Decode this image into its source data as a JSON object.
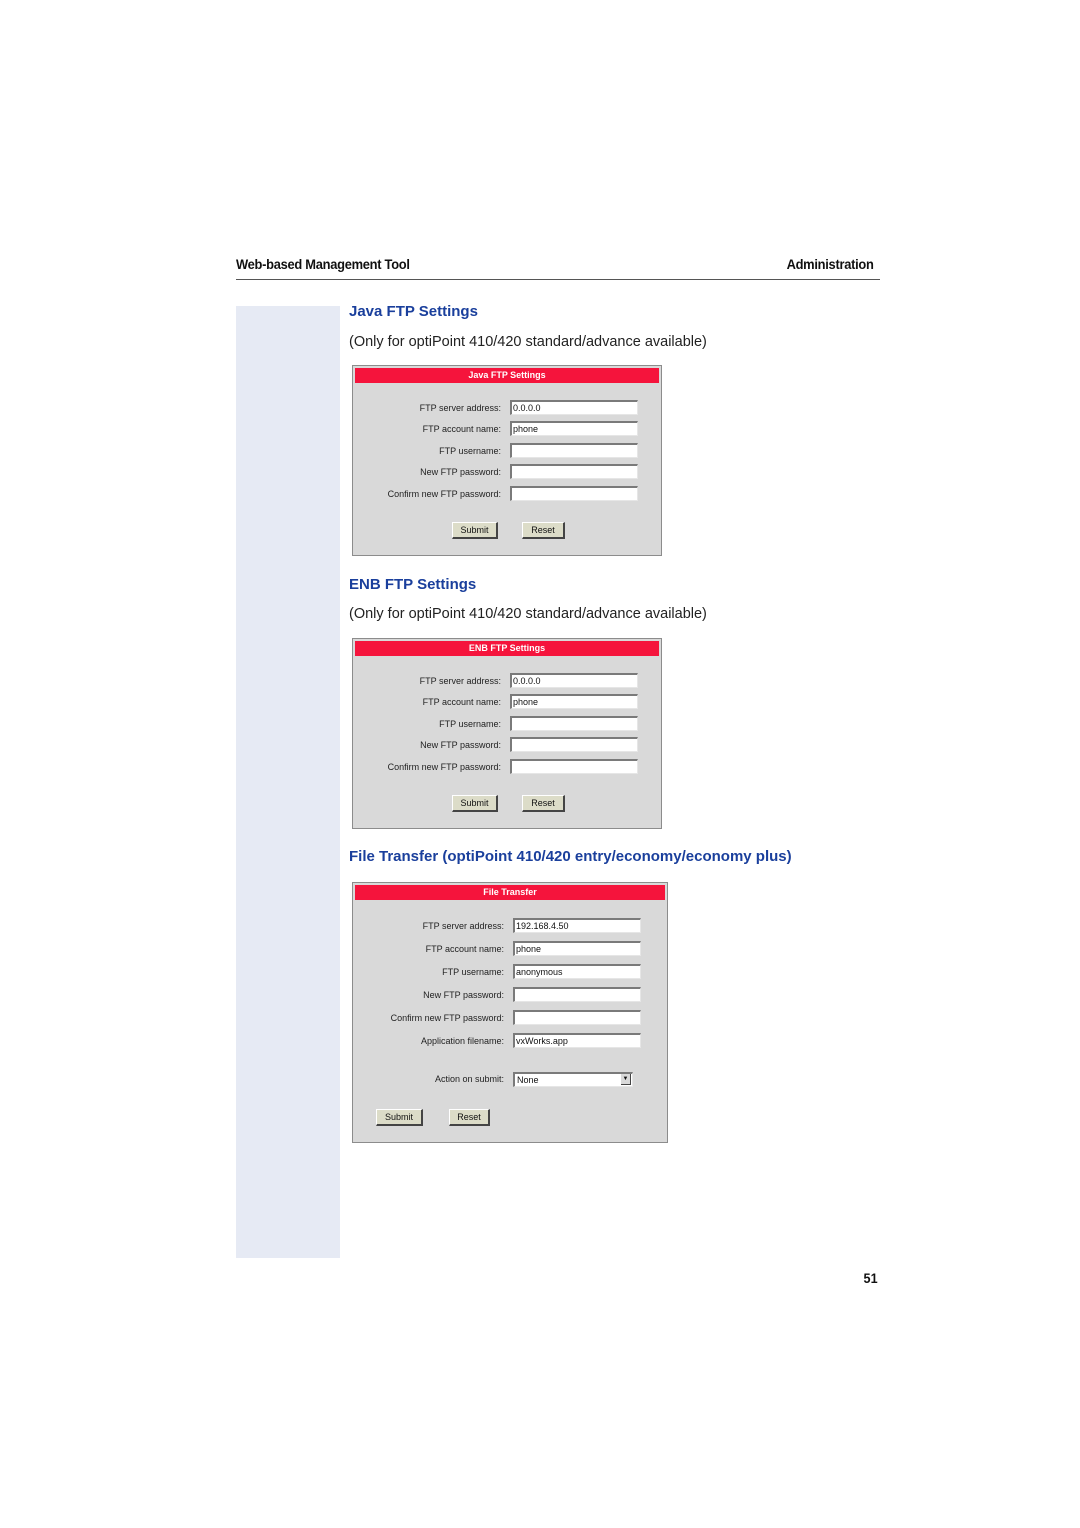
{
  "header": {
    "left": "Web-based Management Tool",
    "right": "Administration"
  },
  "sections": [
    {
      "title": "Java FTP Settings",
      "note": "(Only for optiPoint 410/420 standard/advance available)",
      "panel": {
        "title": "Java FTP Settings",
        "fields": [
          {
            "label": "FTP server address:",
            "value": "0.0.0.0"
          },
          {
            "label": "FTP account name:",
            "value": "phone"
          },
          {
            "label": "FTP username:",
            "value": ""
          },
          {
            "label": "New FTP password:",
            "value": ""
          },
          {
            "label": "Confirm new FTP password:",
            "value": ""
          }
        ],
        "submit": "Submit",
        "reset": "Reset"
      }
    },
    {
      "title": "ENB FTP Settings",
      "note": "(Only for optiPoint 410/420 standard/advance available)",
      "panel": {
        "title": "ENB FTP Settings",
        "fields": [
          {
            "label": "FTP server address:",
            "value": "0.0.0.0"
          },
          {
            "label": "FTP account name:",
            "value": "phone"
          },
          {
            "label": "FTP username:",
            "value": ""
          },
          {
            "label": "New FTP password:",
            "value": ""
          },
          {
            "label": "Confirm new FTP password:",
            "value": ""
          }
        ],
        "submit": "Submit",
        "reset": "Reset"
      }
    },
    {
      "title": "File Transfer (optiPoint 410/420 entry/economy/economy plus)",
      "panel": {
        "title": "File Transfer",
        "fields": [
          {
            "label": "FTP server address:",
            "value": "192.168.4.50"
          },
          {
            "label": "FTP account name:",
            "value": "phone"
          },
          {
            "label": "FTP username:",
            "value": "anonymous"
          },
          {
            "label": "New FTP password:",
            "value": ""
          },
          {
            "label": "Confirm new FTP password:",
            "value": ""
          },
          {
            "label": "Application filename:",
            "value": "vxWorks.app"
          }
        ],
        "action_label": "Action on submit:",
        "action_value": "None",
        "submit": "Submit",
        "reset": "Reset"
      }
    }
  ],
  "page_number": "51"
}
